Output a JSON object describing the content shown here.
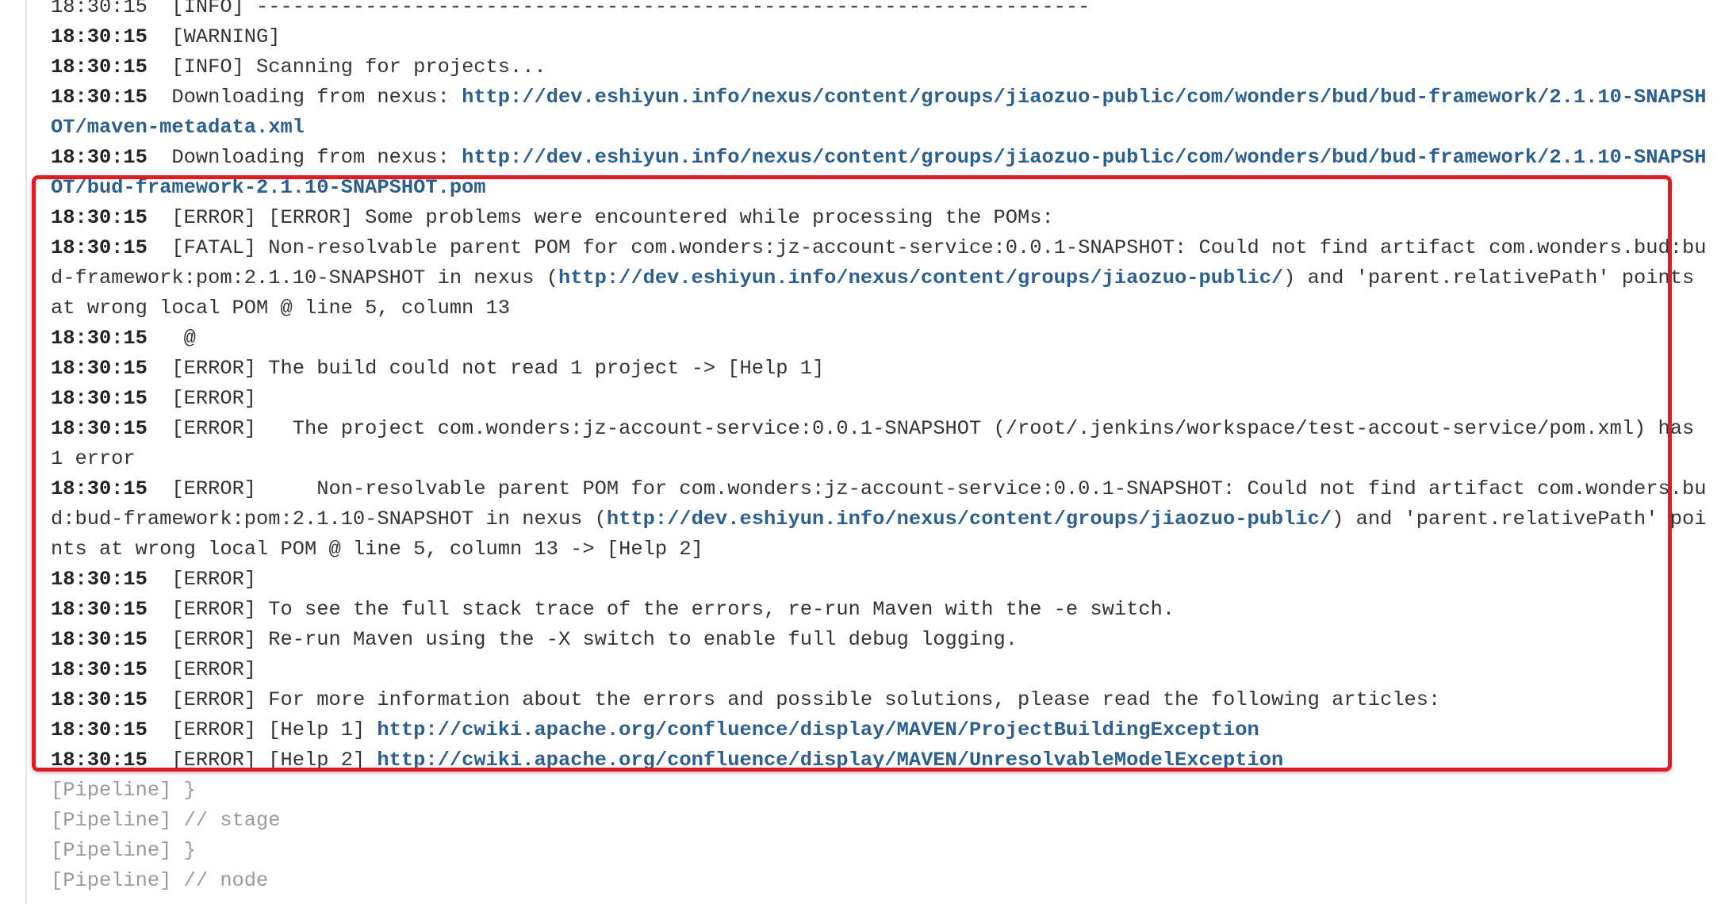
{
  "colors": {
    "link": "#2b5f90",
    "pipeline": "#9a9a9a",
    "highlight_border": "#e01b24",
    "text": "#333333"
  },
  "log": {
    "first_partial": "18:30:15  [INFO] ---------------------------------------------------------------------",
    "lines": [
      {
        "ts": "18:30:15",
        "pre": "[WARNING]",
        "link": "",
        "post": ""
      },
      {
        "ts": "18:30:15",
        "pre": "[INFO] Scanning for projects...",
        "link": "",
        "post": ""
      },
      {
        "ts": "18:30:15",
        "pre": "Downloading from nexus: ",
        "link": "http://dev.eshiyun.info/nexus/content/groups/jiaozuo-public/com/wonders/bud/bud-framework/2.1.10-SNAPSHOT/maven-metadata.xml",
        "post": ""
      },
      {
        "ts": "18:30:15",
        "pre": "Downloading from nexus: ",
        "link": "http://dev.eshiyun.info/nexus/content/groups/jiaozuo-public/com/wonders/bud/bud-framework/2.1.10-SNAPSHOT/bud-framework-2.1.10-SNAPSHOT.pom",
        "post": ""
      },
      {
        "ts": "18:30:15",
        "pre": "[ERROR] [ERROR] Some problems were encountered while processing the POMs:",
        "link": "",
        "post": ""
      },
      {
        "ts": "18:30:15",
        "pre": "[FATAL] Non-resolvable parent POM for com.wonders:jz-account-service:0.0.1-SNAPSHOT: Could not find artifact com.wonders.bud:bud-framework:pom:2.1.10-SNAPSHOT in nexus (",
        "link": "http://dev.eshiyun.info/nexus/content/groups/jiaozuo-public/",
        "post": ") and 'parent.relativePath' points at wrong local POM @ line 5, column 13"
      },
      {
        "ts": "18:30:15",
        "pre": " @",
        "link": "",
        "post": ""
      },
      {
        "ts": "18:30:15",
        "pre": "[ERROR] The build could not read 1 project -> [Help 1]",
        "link": "",
        "post": ""
      },
      {
        "ts": "18:30:15",
        "pre": "[ERROR]",
        "link": "",
        "post": ""
      },
      {
        "ts": "18:30:15",
        "pre": "[ERROR]   The project com.wonders:jz-account-service:0.0.1-SNAPSHOT (/root/.jenkins/workspace/test-accout-service/pom.xml) has 1 error",
        "link": "",
        "post": ""
      },
      {
        "ts": "18:30:15",
        "pre": "[ERROR]     Non-resolvable parent POM for com.wonders:jz-account-service:0.0.1-SNAPSHOT: Could not find artifact com.wonders.bud:bud-framework:pom:2.1.10-SNAPSHOT in nexus (",
        "link": "http://dev.eshiyun.info/nexus/content/groups/jiaozuo-public/",
        "post": ") and 'parent.relativePath' points at wrong local POM @ line 5, column 13 -> [Help 2]"
      },
      {
        "ts": "18:30:15",
        "pre": "[ERROR]",
        "link": "",
        "post": ""
      },
      {
        "ts": "18:30:15",
        "pre": "[ERROR] To see the full stack trace of the errors, re-run Maven with the -e switch.",
        "link": "",
        "post": ""
      },
      {
        "ts": "18:30:15",
        "pre": "[ERROR] Re-run Maven using the -X switch to enable full debug logging.",
        "link": "",
        "post": ""
      },
      {
        "ts": "18:30:15",
        "pre": "[ERROR]",
        "link": "",
        "post": ""
      },
      {
        "ts": "18:30:15",
        "pre": "[ERROR] For more information about the errors and possible solutions, please read the following articles:",
        "link": "",
        "post": ""
      },
      {
        "ts": "18:30:15",
        "pre": "[ERROR] [Help 1] ",
        "link": "http://cwiki.apache.org/confluence/display/MAVEN/ProjectBuildingException",
        "post": ""
      },
      {
        "ts": "18:30:15",
        "pre": "[ERROR] [Help 2] ",
        "link": "http://cwiki.apache.org/confluence/display/MAVEN/UnresolvableModelException",
        "post": ""
      }
    ],
    "pipeline": [
      "[Pipeline] }",
      "[Pipeline] // stage",
      "[Pipeline] }",
      "[Pipeline] // node"
    ]
  }
}
